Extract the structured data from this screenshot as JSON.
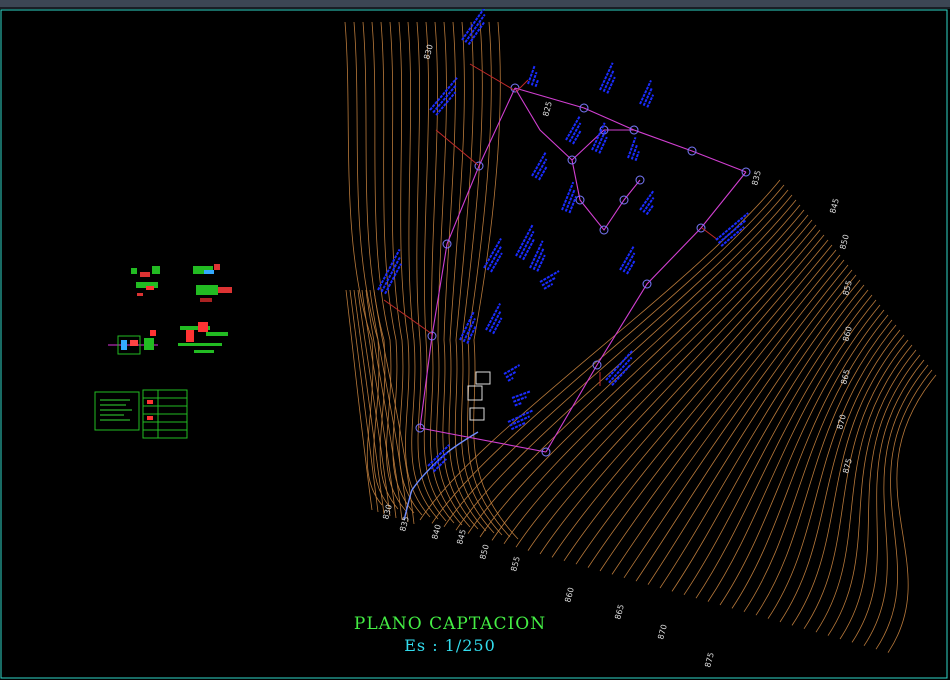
{
  "drawing": {
    "title": "PLANO  CAPTACION",
    "scale": "Es : 1/250",
    "colors": {
      "background": "#000000",
      "contour": "#b8793a",
      "pipe": "#d13fd1",
      "annotation": "#1a2cff",
      "leader": "#c22a2a",
      "title": "#44ee44",
      "scale": "#33ddee",
      "frame": "#2fd6c8"
    },
    "contour_labels": {
      "left_top": [
        "830",
        "825"
      ],
      "right_top": [
        "835"
      ],
      "right_side": [
        "845",
        "850",
        "855",
        "860",
        "865",
        "870",
        "875"
      ],
      "bottom": [
        "830",
        "835",
        "840",
        "845",
        "850",
        "855",
        "860",
        "865",
        "870",
        "875"
      ]
    },
    "notes": [
      "TUBO PROYECTADO CLASE 10 FIERRO GALVANIZADO",
      "TUBO PROYECTADO CLASE 10 FIERRO GALVANIZADO",
      "TUBO PROYECTADO CLASE 10 FIERRO GALVANIZADO",
      "TUBO PROYECTADO CLASE 10 FIERRO GALVANIZADO",
      "TUBO PROYECTADO CLASE 10 FIERRO GALVANIZADO"
    ]
  }
}
